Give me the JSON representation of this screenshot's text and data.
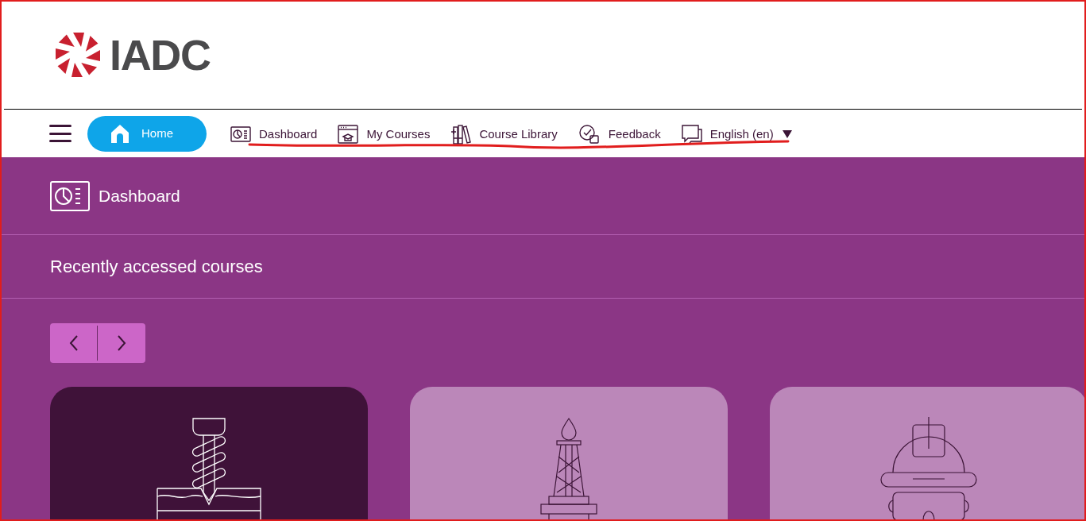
{
  "logo": {
    "text": "IADC"
  },
  "home_button": {
    "label": "Home"
  },
  "nav_items": [
    {
      "kind": "dashboard",
      "label": "Dashboard"
    },
    {
      "kind": "courses",
      "label": "My Courses"
    },
    {
      "kind": "library",
      "label": "Course Library"
    },
    {
      "kind": "feedback",
      "label": "Feedback"
    },
    {
      "kind": "language",
      "label": "English (en)",
      "dropdown": true
    }
  ],
  "page_title": "Dashboard",
  "section_title": "Recently accessed courses",
  "courses": [
    {
      "kind": "drill",
      "highlighted": true
    },
    {
      "kind": "rig",
      "highlighted": false
    },
    {
      "kind": "helmet",
      "highlighted": false
    }
  ]
}
